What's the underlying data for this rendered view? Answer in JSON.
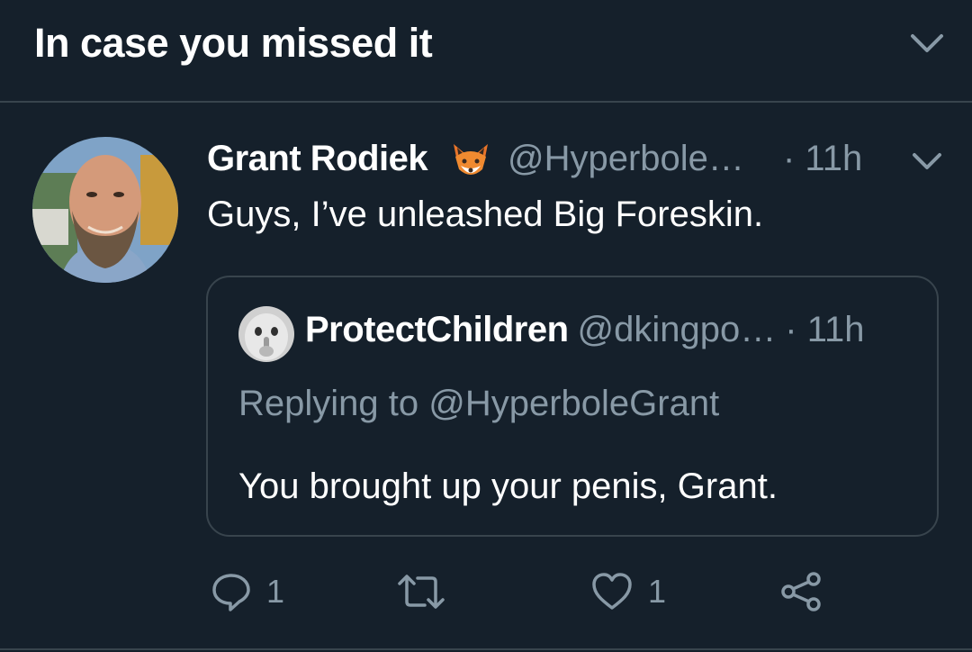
{
  "section": {
    "title": "In case you missed it"
  },
  "tweet": {
    "author_name": "Grant Rodiek",
    "author_emoji": "fox-face-icon",
    "handle": "@Hyperbole…",
    "time": "· 11h",
    "text": "Guys, I’ve unleashed Big Foreskin.",
    "quoted": {
      "author_name": "ProtectChildren",
      "handle": "@dkingpo…",
      "time": "· 11h",
      "replying_to": "Replying to @HyperboleGrant",
      "text": "You brought up your penis, Grant."
    },
    "actions": {
      "reply_count": "1",
      "like_count": "1"
    }
  },
  "colors": {
    "background": "#15202b",
    "border": "#38444d",
    "secondary_text": "#8899a6",
    "primary_text": "#ffffff"
  }
}
